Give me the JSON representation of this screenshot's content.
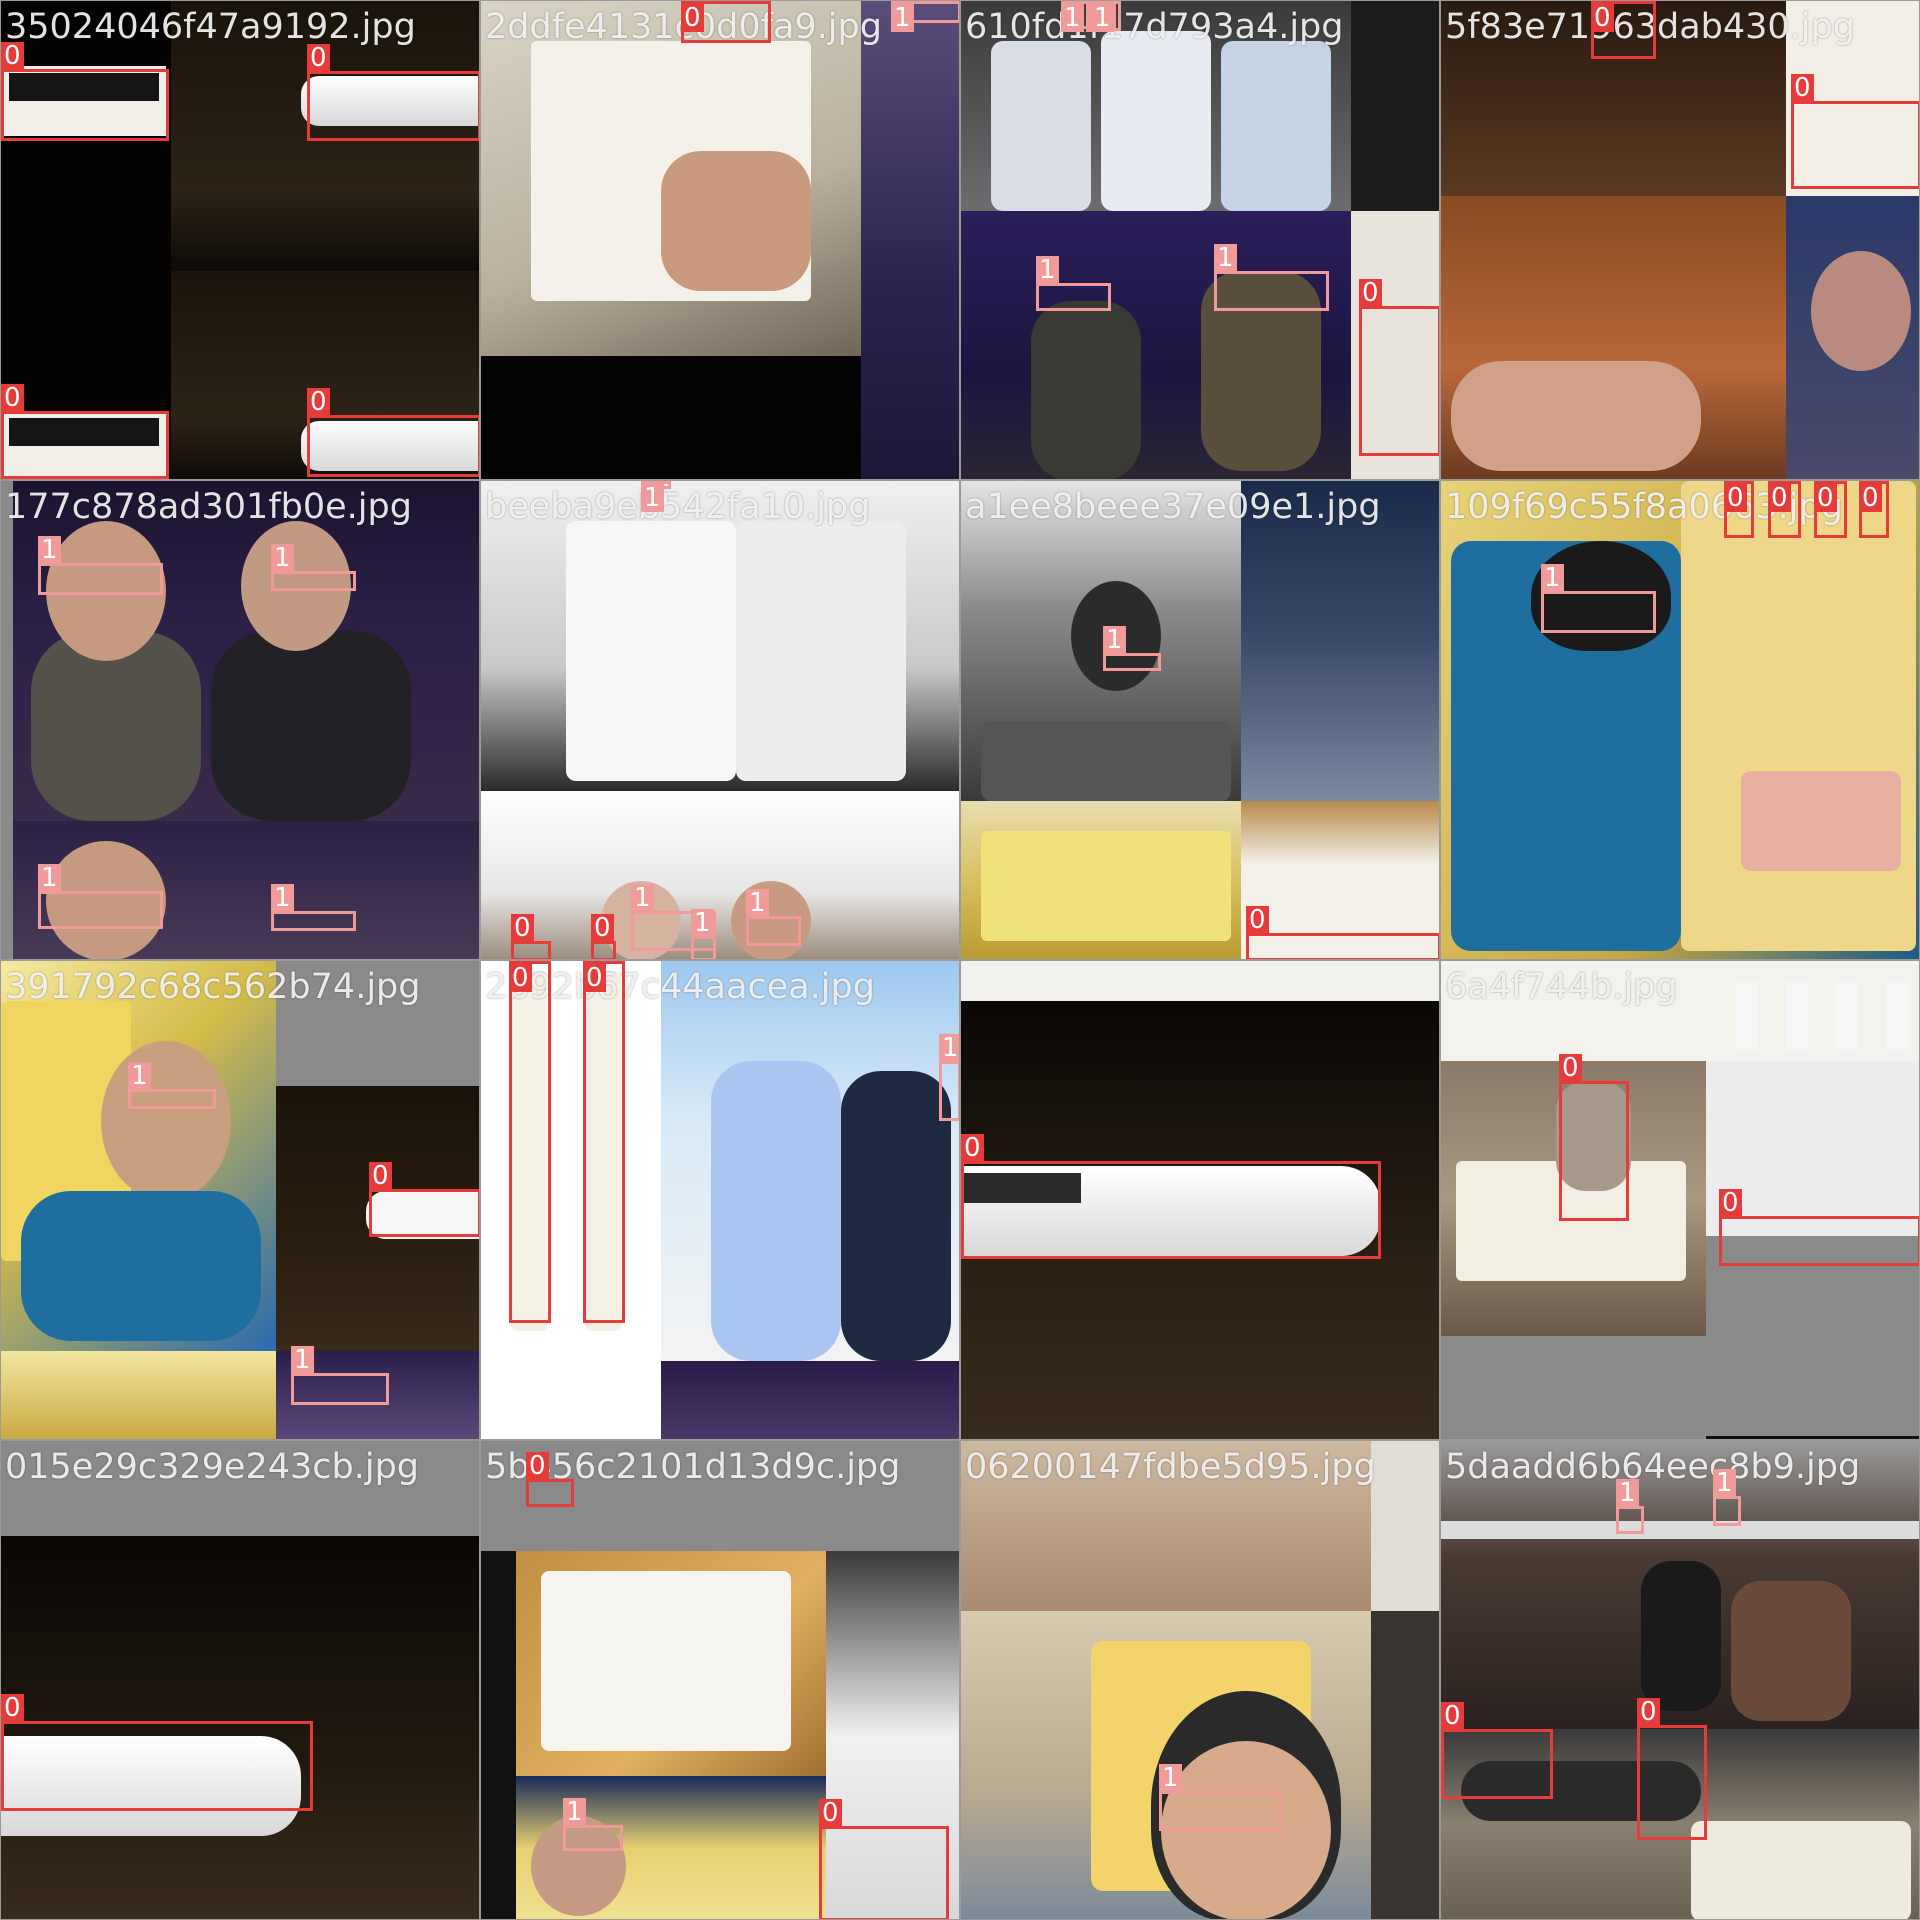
{
  "mosaic": {
    "class_colors": {
      "0": "#e63b3b",
      "1": "#f09a9a"
    },
    "tiles": [
      {
        "label": "35024046f47a9192.jpg",
        "boxes": [
          {
            "c": "0"
          },
          {
            "c": "0"
          },
          {
            "c": "0"
          },
          {
            "c": "0"
          }
        ]
      },
      {
        "label": "2ddfe4131c0d0fa9.jpg",
        "boxes": [
          {
            "c": "0"
          },
          {
            "c": "1"
          }
        ]
      },
      {
        "label": "610fd1f17d793a4.jpg",
        "boxes": [
          {
            "c": "1"
          },
          {
            "c": "1"
          },
          {
            "c": "1"
          },
          {
            "c": "1"
          },
          {
            "c": "1"
          },
          {
            "c": "0"
          }
        ]
      },
      {
        "label": "5f83e71963dab430.jpg",
        "boxes": [
          {
            "c": "0"
          },
          {
            "c": "0"
          }
        ]
      },
      {
        "label": "177c878ad301fb0e.jpg",
        "boxes": [
          {
            "c": "1"
          },
          {
            "c": "1"
          },
          {
            "c": "1"
          },
          {
            "c": "1"
          }
        ]
      },
      {
        "label": "beeba9eb542fa10.jpg",
        "boxes": [
          {
            "c": "1"
          },
          {
            "c": "1"
          },
          {
            "c": "1"
          },
          {
            "c": "1"
          },
          {
            "c": "0"
          },
          {
            "c": "0"
          }
        ]
      },
      {
        "label": "a1ee8beee37e09e1.jpg",
        "boxes": [
          {
            "c": "1"
          },
          {
            "c": "0"
          }
        ]
      },
      {
        "label": "109f69c55f8a0663.jpg",
        "boxes": [
          {
            "c": "1"
          },
          {
            "c": "0"
          },
          {
            "c": "0"
          },
          {
            "c": "0"
          },
          {
            "c": "0"
          }
        ]
      },
      {
        "label": "391792c68c562b74.jpg",
        "boxes": [
          {
            "c": "1"
          },
          {
            "c": "0"
          },
          {
            "c": "1"
          }
        ]
      },
      {
        "label": "2b92b67c44aacea.jpg",
        "boxes": [
          {
            "c": "0"
          },
          {
            "c": "0"
          },
          {
            "c": "1"
          }
        ]
      },
      {
        "label": "",
        "boxes": [
          {
            "c": "0"
          }
        ]
      },
      {
        "label": "6a4f744b.jpg",
        "boxes": [
          {
            "c": "0"
          },
          {
            "c": "0"
          }
        ]
      },
      {
        "label": "015e29c329e243cb.jpg",
        "boxes": [
          {
            "c": "0"
          }
        ]
      },
      {
        "label": "5b456c2101d13d9c.jpg",
        "boxes": [
          {
            "c": "0"
          },
          {
            "c": "1"
          },
          {
            "c": "0"
          }
        ]
      },
      {
        "label": "06200147fdbe5d95.jpg",
        "boxes": [
          {
            "c": "1"
          }
        ]
      },
      {
        "label": "5daadd6b64eec8b9.jpg",
        "boxes": [
          {
            "c": "1"
          },
          {
            "c": "1"
          },
          {
            "c": "0"
          },
          {
            "c": "0"
          }
        ]
      }
    ]
  }
}
